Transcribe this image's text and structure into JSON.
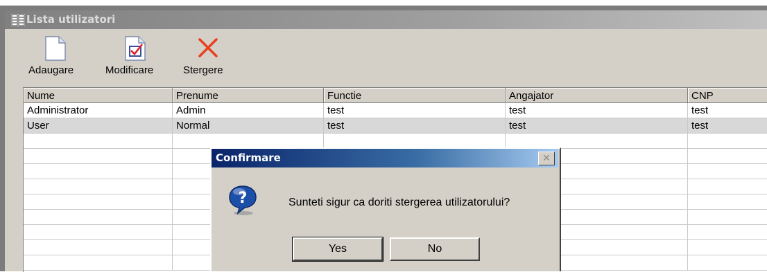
{
  "window": {
    "title": "Lista utilizatori",
    "title_icon": "grid-list-icon"
  },
  "toolbar": {
    "add_label": "Adaugare",
    "edit_label": "Modificare",
    "delete_label": "Stergere"
  },
  "table": {
    "columns": [
      "Nume",
      "Prenume",
      "Functie",
      "Angajator",
      "CNP"
    ],
    "rows": [
      [
        "Administrator",
        "Admin",
        "test",
        "test",
        "test"
      ],
      [
        "User",
        "Normal",
        "test",
        "test",
        "test"
      ]
    ]
  },
  "dialog": {
    "title": "Confirmare",
    "close_symbol": "✕",
    "icon": "question-icon",
    "message": "Sunteti sigur ca doriti stergerea utilizatorului?",
    "yes_label": "Yes",
    "no_label": "No"
  },
  "colors": {
    "dialog_title_start": "#0a246a",
    "dialog_title_end": "#a6caf0",
    "delete_icon": "#e8401c",
    "question_icon": "#1c4fa8"
  }
}
